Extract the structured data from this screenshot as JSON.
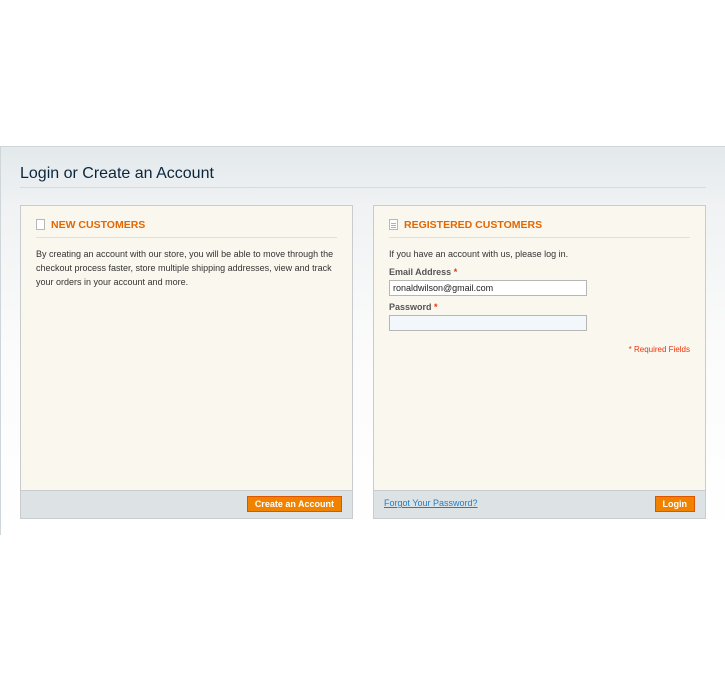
{
  "page": {
    "title": "Login or Create an Account"
  },
  "new_customers": {
    "heading": "NEW CUSTOMERS",
    "icon": "page-icon",
    "description": "By creating an account with our store, you will be able to move through the checkout process faster, store multiple shipping addresses, view and track your orders in your account and more.",
    "create_button": "Create an Account"
  },
  "registered_customers": {
    "heading": "REGISTERED CUSTOMERS",
    "icon": "document-icon",
    "intro": "If you have an account with us, please log in.",
    "email_label": "Email Address",
    "email_value": "ronaldwilson@gmail.com",
    "password_label": "Password",
    "password_value": "",
    "required_marker": "*",
    "required_note": "* Required Fields",
    "forgot_link": "Forgot Your Password?",
    "login_button": "Login"
  },
  "colors": {
    "accent": "#e26703",
    "button": "#f18200",
    "link": "#1e7ec8",
    "required": "#eb340a"
  }
}
